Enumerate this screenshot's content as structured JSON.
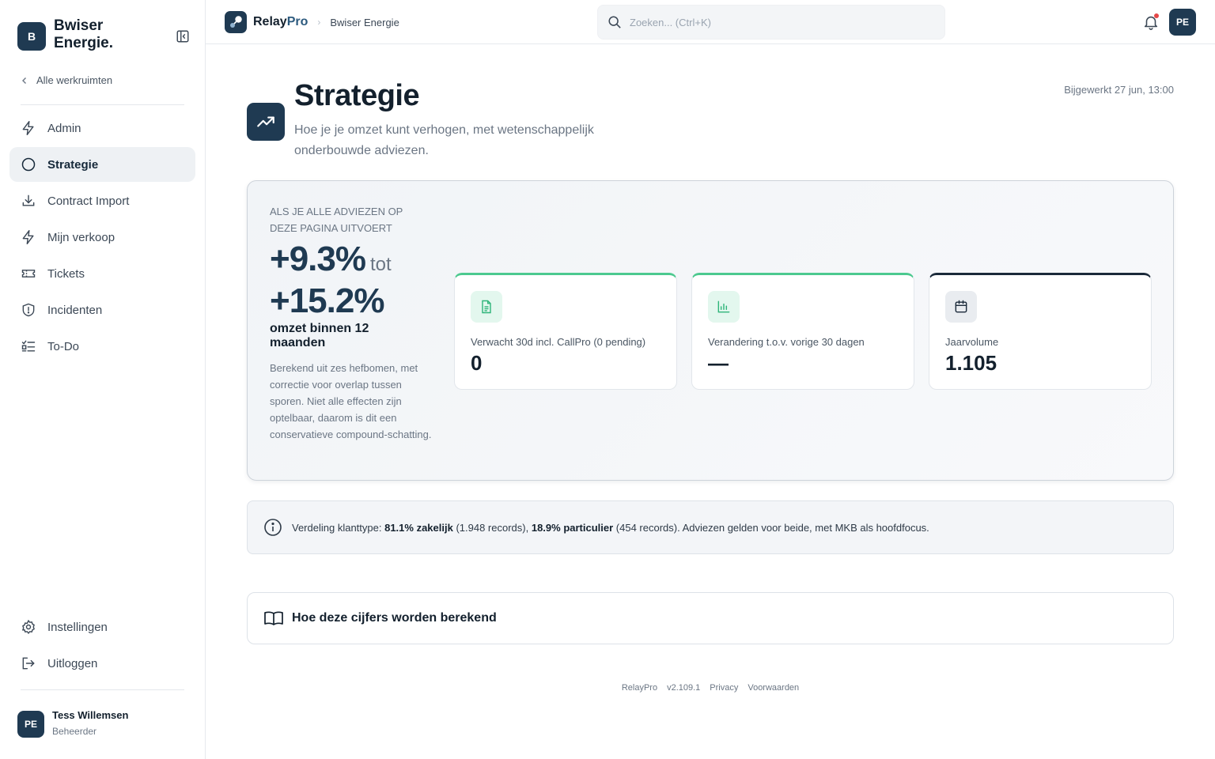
{
  "workspace": {
    "initial": "B",
    "name": "Bwiser Energie.",
    "back_label": "Alle werkruimten"
  },
  "nav": {
    "items": [
      {
        "label": "Admin",
        "icon": "bolt-icon"
      },
      {
        "label": "Strategie",
        "icon": "circle-icon",
        "active": true
      },
      {
        "label": "Contract Import",
        "icon": "download-icon"
      },
      {
        "label": "Mijn verkoop",
        "icon": "bolt-icon"
      },
      {
        "label": "Tickets",
        "icon": "ticket-icon"
      },
      {
        "label": "Incidenten",
        "icon": "shield-icon"
      },
      {
        "label": "To-Do",
        "icon": "checklist-icon"
      }
    ],
    "bottom": [
      {
        "label": "Instellingen",
        "icon": "gear-icon"
      },
      {
        "label": "Uitloggen",
        "icon": "logout-icon"
      }
    ]
  },
  "user": {
    "initials": "PE",
    "name": "Tess Willemsen",
    "role": "Beheerder"
  },
  "topbar": {
    "brand_main": "Relay",
    "brand_accent": "Pro",
    "breadcrumb": "Bwiser Energie",
    "search_placeholder": "Zoeken... (Ctrl+K)",
    "avatar": "PE"
  },
  "page": {
    "title": "Strategie",
    "subtitle": "Hoe je je omzet kunt verhogen, met wetenschappelijk onderbouwde adviezen.",
    "updated": "Bijgewerkt 27 jun, 13:00"
  },
  "hero": {
    "eyebrow": "Als je alle adviezen op deze pagina uitvoert",
    "range_low": "+9.3%",
    "range_sep": "tot",
    "range_high": "+15.2%",
    "label": "omzet binnen 12 maanden",
    "note": "Berekend uit zes hefbomen, met correctie voor overlap tussen sporen. Niet alle effecten zijn optelbaar, daarom is dit een conservatieve compound-schatting."
  },
  "stats": [
    {
      "label": "Verwacht 30d incl. CallPro (0 pending)",
      "value": "0",
      "icon": "document-icon",
      "accent": "#4cc98f"
    },
    {
      "label": "Verandering t.o.v. vorige 30 dagen",
      "value": "—",
      "icon": "bar-chart-icon",
      "accent": "#4cc98f"
    },
    {
      "label": "Jaarvolume",
      "value": "1.105",
      "icon": "calendar-icon",
      "accent": "#1b2a3a"
    }
  ],
  "info": {
    "prefix": "Verdeling klanttype:",
    "business_pct": "81.1% zakelijk",
    "business_records": "(1.948 records),",
    "private_pct": "18.9% particulier",
    "private_records": "(454 records). Adviezen gelden voor beide, met MKB als hoofdfocus."
  },
  "howto": {
    "label": "Hoe deze cijfers worden berekend"
  },
  "footer": {
    "brand": "RelayPro",
    "version": "v2.109.1",
    "privacy": "Privacy",
    "terms": "Voorwaarden"
  },
  "colors": {
    "brand": "#1f3a52",
    "accent_green": "#4cc98f",
    "notification": "#e54848"
  }
}
